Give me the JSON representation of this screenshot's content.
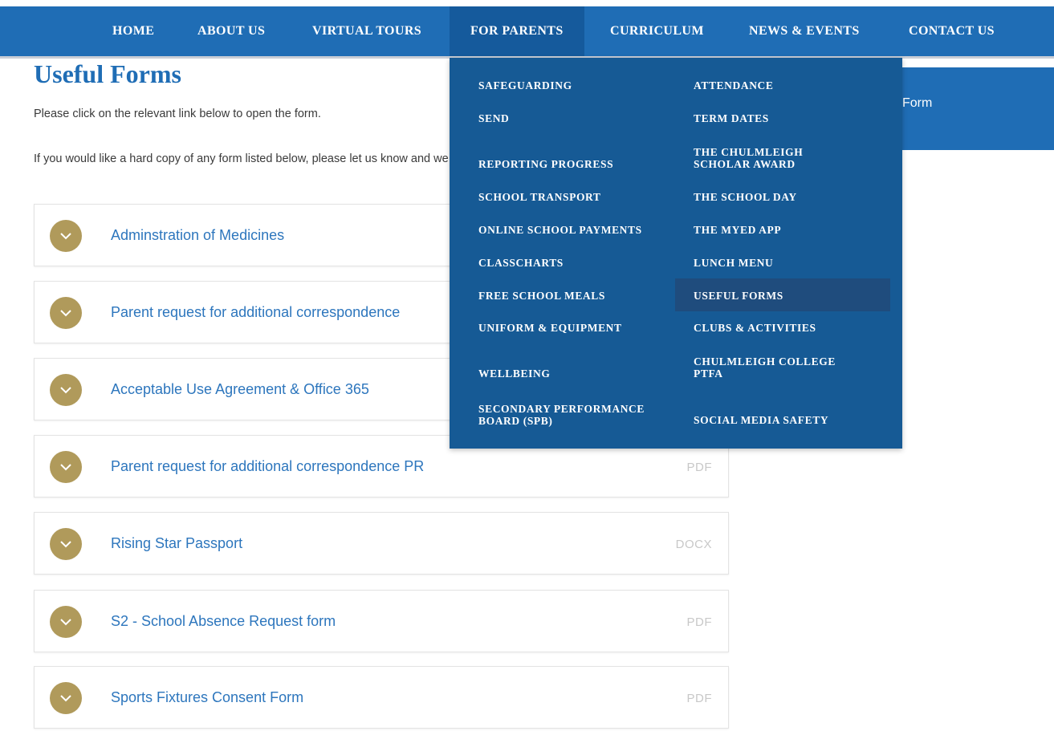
{
  "nav": {
    "items": [
      "HOME",
      "ABOUT US",
      "VIRTUAL TOURS",
      "FOR PARENTS",
      "CURRICULUM",
      "NEWS & EVENTS",
      "CONTACT US"
    ],
    "active": "FOR PARENTS"
  },
  "page": {
    "title": "Useful Forms",
    "intro_1": "Please click on the relevant link below to open the form.",
    "intro_2": "If you would like a hard copy of any form listed below, please let us know and we will be happy to provide you with one.",
    "right_banner_text": "Form"
  },
  "forms": [
    {
      "title": "Adminstration of Medicines",
      "type": ""
    },
    {
      "title": "Parent request for additional correspondence",
      "type": ""
    },
    {
      "title": "Acceptable Use Agreement & Office 365",
      "type": ""
    },
    {
      "title": "Parent request for additional correspondence PR",
      "type": "PDF"
    },
    {
      "title": "Rising Star Passport",
      "type": "DOCX"
    },
    {
      "title": "S2 - School Absence Request form",
      "type": "PDF"
    },
    {
      "title": "Sports Fixtures Consent Form",
      "type": "PDF"
    }
  ],
  "dropdown": {
    "left": [
      "SAFEGUARDING",
      "SEND",
      "REPORTING PROGRESS",
      "SCHOOL TRANSPORT",
      "ONLINE SCHOOL PAYMENTS",
      "CLASSCHARTS",
      "FREE SCHOOL MEALS",
      "UNIFORM & EQUIPMENT",
      "WELLBEING",
      "SECONDARY PERFORMANCE BOARD (SPB)"
    ],
    "right": [
      "ATTENDANCE",
      "TERM DATES",
      "THE CHULMLEIGH SCHOLAR AWARD",
      "THE SCHOOL DAY",
      "THE MYED APP",
      "LUNCH MENU",
      "USEFUL FORMS",
      "CLUBS & ACTIVITIES",
      "CHULMLEIGH COLLEGE PTFA",
      "SOCIAL MEDIA SAFETY"
    ],
    "highlighted": "USEFUL FORMS"
  },
  "colors": {
    "nav_bg": "#1f6db5",
    "dropdown_bg": "#165a95",
    "accent_gold": "#b09a5b",
    "link_blue": "#2d76bd"
  }
}
